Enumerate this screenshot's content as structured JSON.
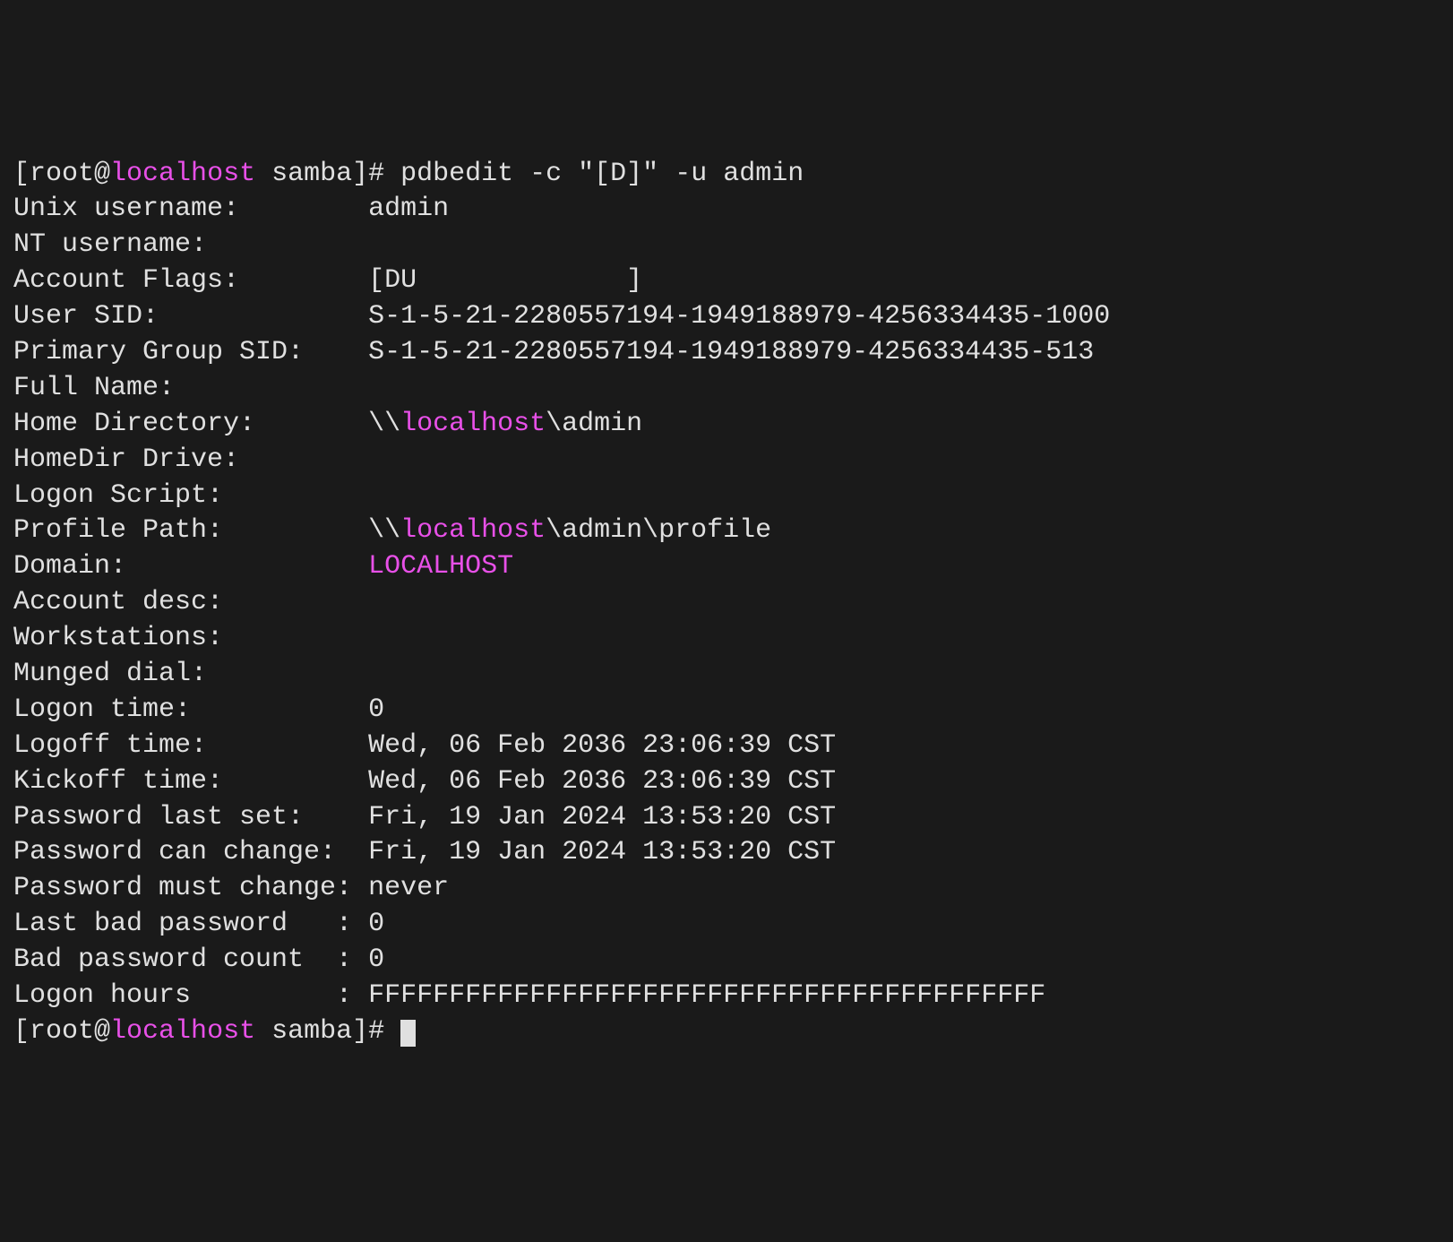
{
  "prompt": {
    "bracket_open": "[",
    "user": "root",
    "at": "@",
    "host": "localhost",
    "space": " ",
    "dir": "samba",
    "bracket_close": "]",
    "hash": "# ",
    "command": "pdbedit -c \"[D]\" -u admin"
  },
  "fields": {
    "unix_username": {
      "label": "Unix username:        ",
      "value": "admin"
    },
    "nt_username": {
      "label": "NT username:"
    },
    "account_flags": {
      "label": "Account Flags:        ",
      "value": "[DU             ]"
    },
    "user_sid": {
      "label": "User SID:             ",
      "value": "S-1-5-21-2280557194-1949188979-4256334435-1000"
    },
    "primary_group_sid": {
      "label": "Primary Group SID:    ",
      "value": "S-1-5-21-2280557194-1949188979-4256334435-513"
    },
    "full_name": {
      "label": "Full Name:"
    },
    "home_directory": {
      "label": "Home Directory:       ",
      "prefix": "\\\\",
      "host": "localhost",
      "suffix": "\\admin"
    },
    "homedir_drive": {
      "label": "HomeDir Drive:"
    },
    "logon_script": {
      "label": "Logon Script:"
    },
    "profile_path": {
      "label": "Profile Path:         ",
      "prefix": "\\\\",
      "host": "localhost",
      "suffix": "\\admin\\profile"
    },
    "domain": {
      "label": "Domain:               ",
      "value": "LOCALHOST"
    },
    "account_desc": {
      "label": "Account desc:"
    },
    "workstations": {
      "label": "Workstations:"
    },
    "munged_dial": {
      "label": "Munged dial:"
    },
    "logon_time": {
      "label": "Logon time:           ",
      "value": "0"
    },
    "logoff_time": {
      "label": "Logoff time:          ",
      "value": "Wed, 06 Feb 2036 23:06:39 CST"
    },
    "kickoff_time": {
      "label": "Kickoff time:         ",
      "value": "Wed, 06 Feb 2036 23:06:39 CST"
    },
    "password_last_set": {
      "label": "Password last set:    ",
      "value": "Fri, 19 Jan 2024 13:53:20 CST"
    },
    "password_can_change": {
      "label": "Password can change:  ",
      "value": "Fri, 19 Jan 2024 13:53:20 CST"
    },
    "password_must_change": {
      "label": "Password must change: ",
      "value": "never"
    },
    "last_bad_password": {
      "label": "Last bad password   : ",
      "value": "0"
    },
    "bad_password_count": {
      "label": "Bad password count  : ",
      "value": "0"
    },
    "logon_hours": {
      "label": "Logon hours         : ",
      "value": "FFFFFFFFFFFFFFFFFFFFFFFFFFFFFFFFFFFFFFFFFF"
    }
  },
  "prompt2": {
    "bracket_open": "[",
    "user": "root",
    "at": "@",
    "host": "localhost",
    "space": " ",
    "dir": "samba",
    "bracket_close": "]",
    "hash": "# "
  }
}
